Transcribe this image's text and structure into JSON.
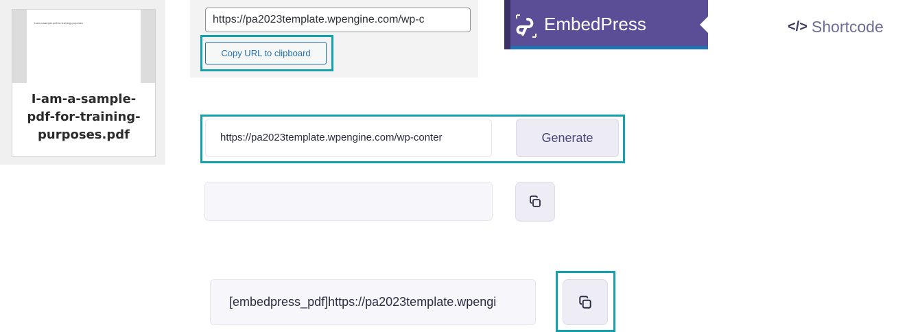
{
  "thumbnail": {
    "preview_text": "I-am-a-sample-pdf-for-training-purposes",
    "name_lines": [
      "I-am-a-sample-",
      "pdf-for-training-",
      "purposes.pdf"
    ]
  },
  "wp_attachment": {
    "url_value": "https://pa2023template.wpengine.com/wp-c",
    "copy_button_label": "Copy URL to clipboard"
  },
  "embedpress": {
    "title": "EmbedPress",
    "brand_color": "#5b4e96"
  },
  "shortcode_tab": {
    "icon": "code-icon",
    "icon_glyph": "</>",
    "label": "Shortcode"
  },
  "generator": {
    "url_value": "https://pa2023template.wpengine.com/wp-conter",
    "generate_label": "Generate",
    "empty_output_value": "",
    "copy_icon": "copy-icon",
    "shortcode_value": "[embedpress_pdf]https://pa2023template.wpengi"
  },
  "colors": {
    "highlight": "#15a0ad",
    "wp_blue": "#2271b1",
    "ep_purple": "#5b4e96"
  }
}
